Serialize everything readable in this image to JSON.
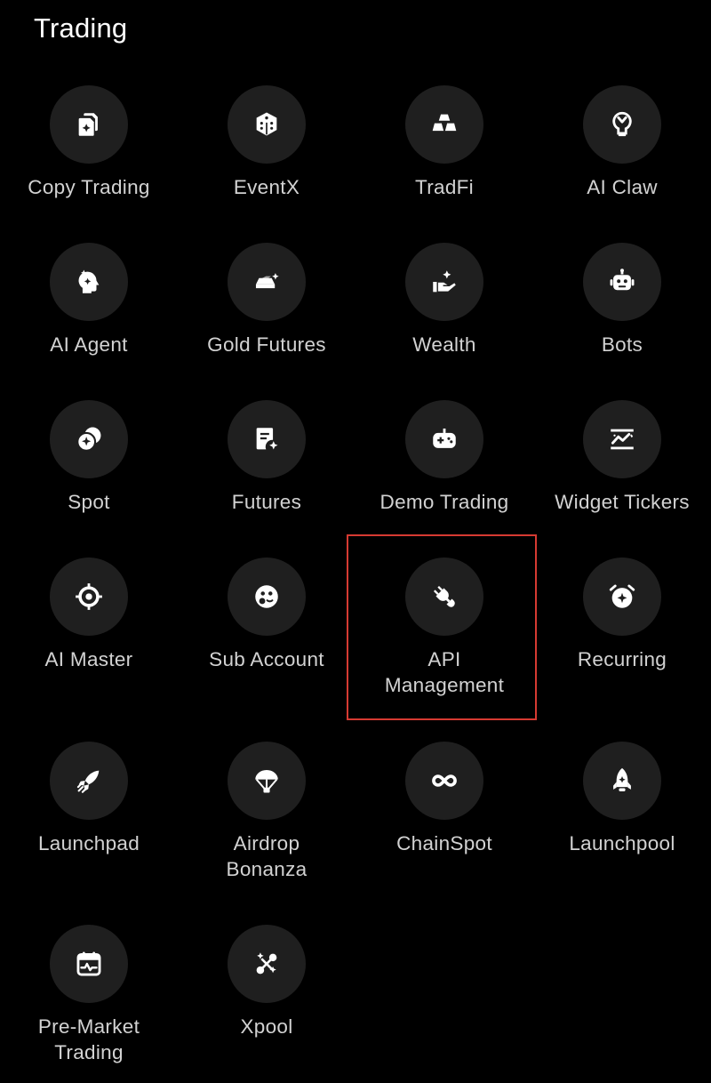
{
  "section": {
    "title": "Trading"
  },
  "colors": {
    "background": "#000000",
    "tile_circle": "#1f1f1f",
    "icon": "#ffffff",
    "label": "#d2d2d2",
    "highlight": "#d63a32"
  },
  "tiles": [
    {
      "label": "Copy Trading",
      "icon": "copy-trading-icon"
    },
    {
      "label": "EventX",
      "icon": "dice-icon"
    },
    {
      "label": "TradFi",
      "icon": "gold-bars-icon"
    },
    {
      "label": "AI Claw",
      "icon": "claw-icon"
    },
    {
      "label": "AI Agent",
      "icon": "ai-head-icon"
    },
    {
      "label": "Gold Futures",
      "icon": "gold-bar-sparkle-icon"
    },
    {
      "label": "Wealth",
      "icon": "hand-coin-icon"
    },
    {
      "label": "Bots",
      "icon": "robot-icon"
    },
    {
      "label": "Spot",
      "icon": "coins-icon"
    },
    {
      "label": "Futures",
      "icon": "document-sparkle-icon"
    },
    {
      "label": "Demo Trading",
      "icon": "gamepad-icon"
    },
    {
      "label": "Widget Tickers",
      "icon": "chart-widget-icon"
    },
    {
      "label": "AI Master",
      "icon": "target-icon"
    },
    {
      "label": "Sub Account",
      "icon": "sub-account-icon"
    },
    {
      "label": "API\nManagement",
      "icon": "plug-icon"
    },
    {
      "label": "Recurring",
      "icon": "alarm-clock-icon"
    },
    {
      "label": "Launchpad",
      "icon": "rocket-icon"
    },
    {
      "label": "Airdrop\nBonanza",
      "icon": "parachute-icon"
    },
    {
      "label": "ChainSpot",
      "icon": "infinity-icon"
    },
    {
      "label": "Launchpool",
      "icon": "rocket-pool-icon"
    },
    {
      "label": "Pre-Market\nTrading",
      "icon": "calendar-pulse-icon"
    },
    {
      "label": "Xpool",
      "icon": "nodes-icon"
    }
  ]
}
